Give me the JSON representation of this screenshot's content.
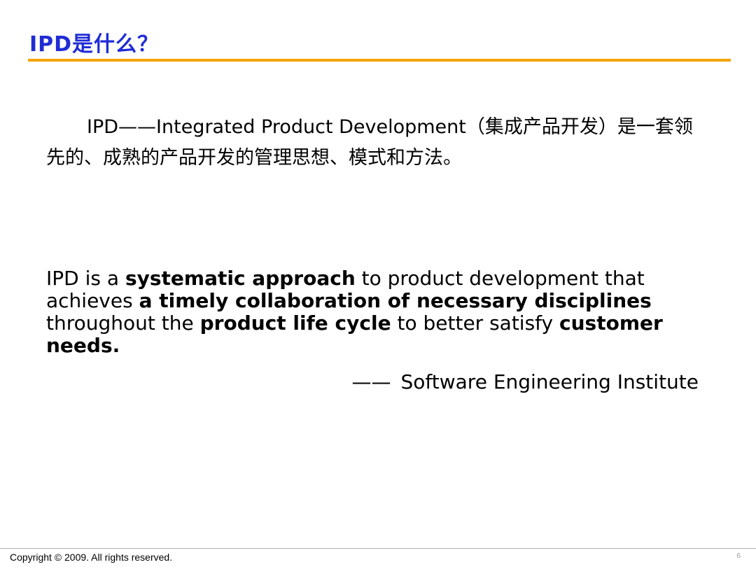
{
  "slide": {
    "title": "IPD是什么？",
    "definition": {
      "text": "IPD——Integrated Product Development（集成产品开发）是一套领先的、成熟的产品开发的管理思想、模式和方法。"
    },
    "quote": {
      "segments": [
        {
          "text": " IPD is a ",
          "bold": false
        },
        {
          "text": "systematic approach",
          "bold": true
        },
        {
          "text": " to product development that achieves ",
          "bold": false
        },
        {
          "text": "a timely collaboration of necessary disciplines",
          "bold": true
        },
        {
          "text": " throughout the ",
          "bold": false
        },
        {
          "text": "product life cycle",
          "bold": true
        },
        {
          "text": " to better satisfy ",
          "bold": false
        },
        {
          "text": "customer needs.",
          "bold": true
        }
      ]
    },
    "attribution": {
      "dash": "——",
      "source": "Software Engineering Institute"
    }
  },
  "footer": {
    "copyright": "Copyright © 2009. All rights reserved.",
    "page_number": "6"
  },
  "colors": {
    "title": "#1f2cd6",
    "rule": "#f5a300"
  }
}
